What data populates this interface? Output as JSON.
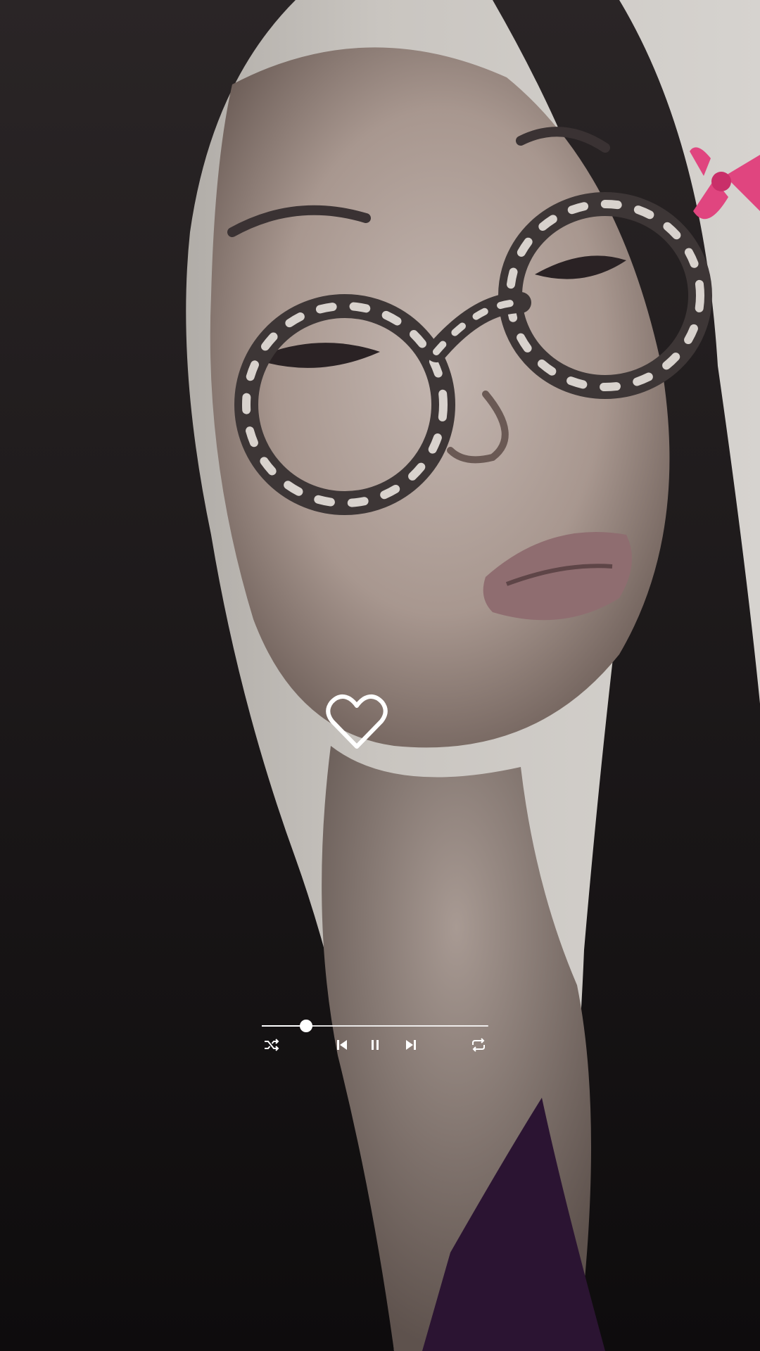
{
  "player": {
    "progress_fraction": 0.195,
    "controls": {
      "shuffle": "shuffle-icon",
      "previous": "previous-icon",
      "pause": "pause-icon",
      "next": "next-icon",
      "repeat": "repeat-icon"
    }
  },
  "heart": {
    "icon": "heart-outline-icon",
    "liked": false
  },
  "colors": {
    "icon": "#ffffff",
    "accent_bow": "#e0457f"
  }
}
